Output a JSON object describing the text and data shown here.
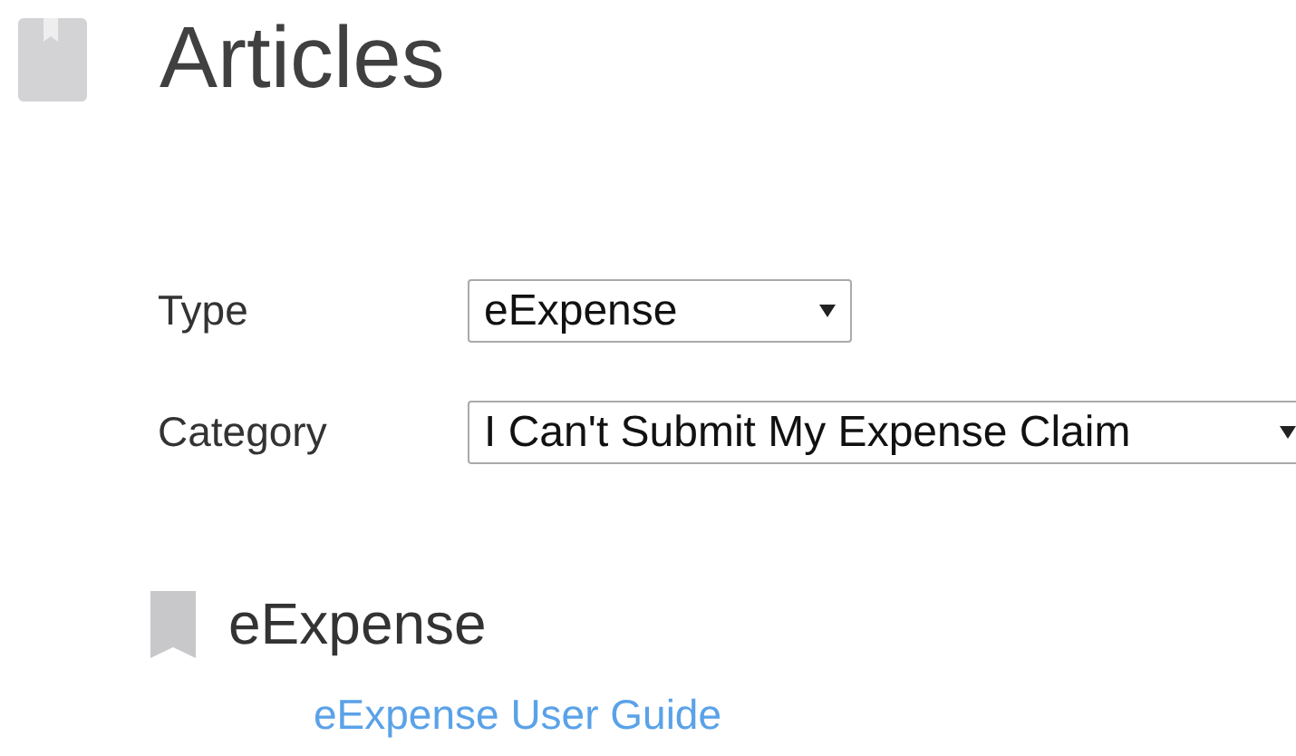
{
  "page": {
    "title": "Articles"
  },
  "filters": [
    {
      "label": "Type",
      "value": "eExpense",
      "kind": "short"
    },
    {
      "label": "Category",
      "value": "I Can't Submit My Expense Claim",
      "kind": "wide"
    }
  ],
  "sections": [
    {
      "heading": "eExpense",
      "links": [
        "eExpense User Guide"
      ]
    }
  ]
}
